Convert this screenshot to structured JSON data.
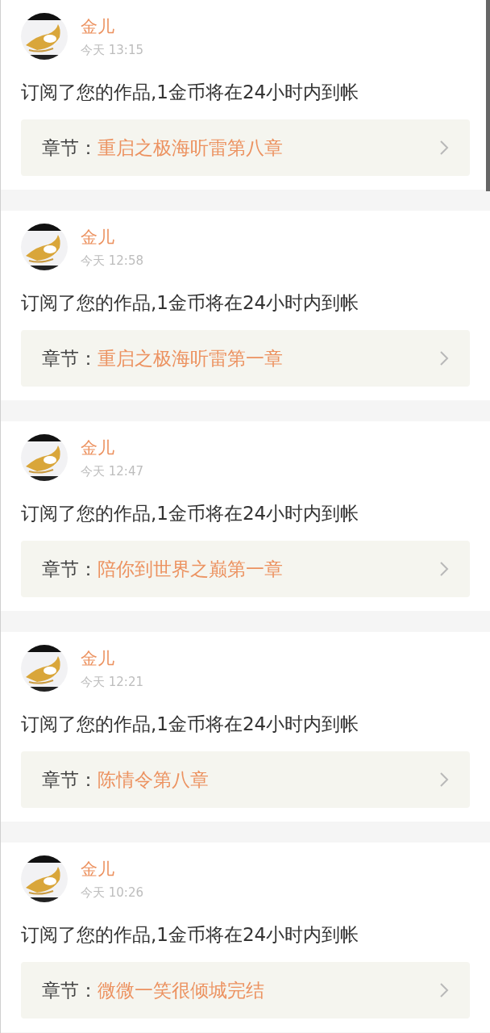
{
  "notifications": [
    {
      "name": "金儿",
      "time": "今天 13:15",
      "message": "订阅了您的作品,1金币将在24小时内到帐",
      "chapter_label": "章节：",
      "chapter_title": "重启之极海听雷第八章"
    },
    {
      "name": "金儿",
      "time": "今天 12:58",
      "message": "订阅了您的作品,1金币将在24小时内到帐",
      "chapter_label": "章节：",
      "chapter_title": "重启之极海听雷第一章"
    },
    {
      "name": "金儿",
      "time": "今天 12:47",
      "message": "订阅了您的作品,1金币将在24小时内到帐",
      "chapter_label": "章节：",
      "chapter_title": "陪你到世界之巅第一章"
    },
    {
      "name": "金儿",
      "time": "今天 12:21",
      "message": "订阅了您的作品,1金币将在24小时内到帐",
      "chapter_label": "章节：",
      "chapter_title": "陈情令第八章"
    },
    {
      "name": "金儿",
      "time": "今天 10:26",
      "message": "订阅了您的作品,1金币将在24小时内到帐",
      "chapter_label": "章节：",
      "chapter_title": "微微一笑很倾城完结"
    }
  ]
}
